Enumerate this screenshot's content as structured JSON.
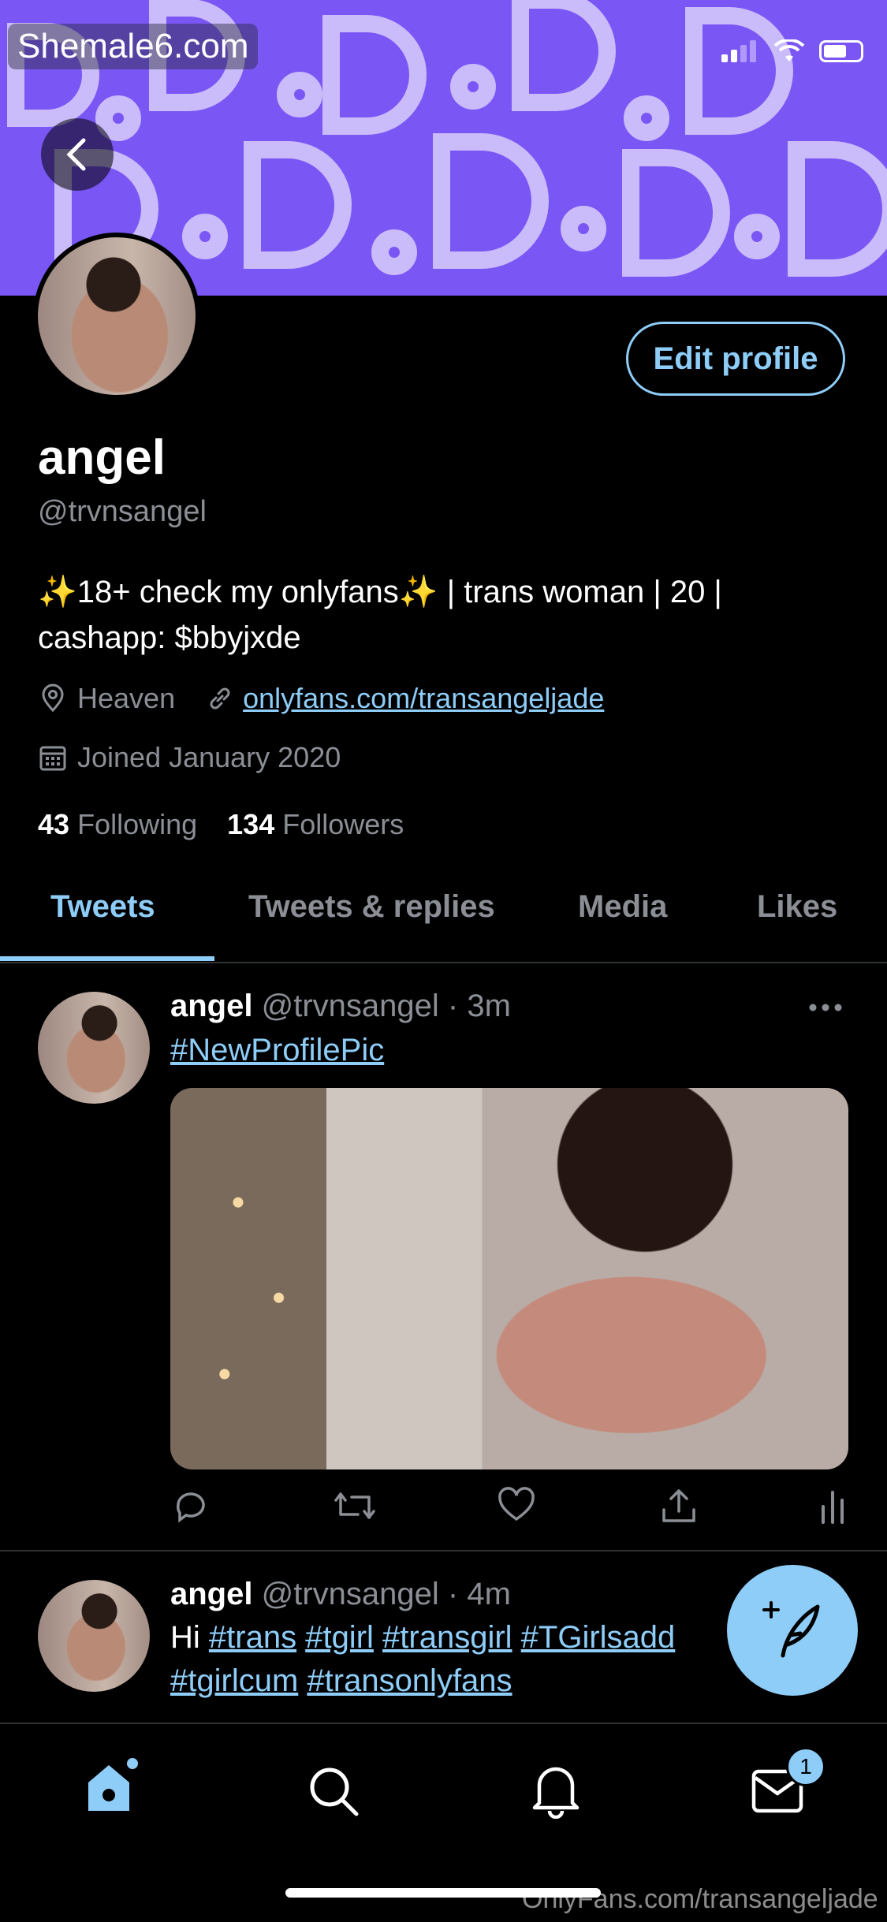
{
  "watermark_top": "Shemale6.com",
  "watermark_bottom": "OnlyFans.com/transangeljade",
  "profile": {
    "name": "angel",
    "handle": "@trvnsangel",
    "bio": "✨18+ check my onlyfans✨ | trans woman | 20 | cashapp: $bbyjxde",
    "location": "Heaven",
    "link": "onlyfans.com/transangeljade",
    "joined": "Joined January 2020",
    "following_count": "43",
    "following_label": "Following",
    "followers_count": "134",
    "followers_label": "Followers",
    "edit_button": "Edit profile"
  },
  "tabs": [
    {
      "label": "Tweets",
      "active": true
    },
    {
      "label": "Tweets & replies",
      "active": false
    },
    {
      "label": "Media",
      "active": false
    },
    {
      "label": "Likes",
      "active": false
    }
  ],
  "tweets": [
    {
      "name": "angel",
      "handle": "@trvnsangel",
      "time": "3m",
      "text_hashtag": "#NewProfilePic"
    },
    {
      "name": "angel",
      "handle": "@trvnsangel",
      "time": "4m",
      "text_prefix": "Hi",
      "hashtags_line1": [
        "#trans",
        "#tgirl",
        "#transgirl",
        "#TGirlsadd"
      ],
      "hashtags_line2": [
        "#tgirlcum",
        "#transonlyfans"
      ]
    }
  ],
  "nav": {
    "messages_badge": "1"
  },
  "colors": {
    "accent": "#8ecdf8",
    "muted": "#8b8f95",
    "background": "#000000"
  },
  "icons": [
    "back-arrow-icon",
    "location-pin-icon",
    "link-icon",
    "calendar-icon",
    "more-icon",
    "reply-icon",
    "retweet-icon",
    "like-icon",
    "share-icon",
    "analytics-icon",
    "compose-feather-icon",
    "home-icon",
    "search-icon",
    "bell-icon",
    "mail-icon"
  ]
}
